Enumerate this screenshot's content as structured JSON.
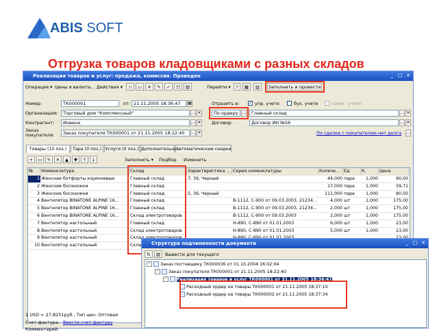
{
  "logo": {
    "brand_bold": "ABIS",
    "brand_rest": " SOFT"
  },
  "slide_title": "Отгрузка товаров кладовщиками с разных складов",
  "window": {
    "title": "Реализация товаров и услуг: продажа, комиссия. Проведен",
    "toolbar": {
      "operation": "Операция ▾",
      "prices": "Цены и валюта...",
      "actions": "Действия ▾",
      "goto": "Перейти ▾",
      "fill_post": "Заполнить и провести"
    },
    "form": {
      "number_label": "Номер:",
      "number_value": "ТК000001",
      "from_label": "от:",
      "date_value": "21.11.2005 18:36:47",
      "reflect_label": "Отразить в:",
      "mgmt_label": "упр. учете",
      "acct_label": "бух. учете",
      "tax_label": "налог. учете",
      "org_label": "Организация:",
      "org_value": "Торговый дом \"Комплексный\"",
      "by_order_value": "По ордеру",
      "warehouse_value": "Главный склад",
      "contractor_label": "Контрагент:",
      "contractor_value": "Инвена",
      "contract_label": "Договор:",
      "contract_value": "Договор ИН №56",
      "buyer_order_label": "Заказ покупателя:",
      "buyer_order_value": "Заказ покупателя ТК000001 от 21.11.2005 18:22:40",
      "debt_link": "По сделке с покупателем нет долга"
    },
    "tabs": [
      "Товары (10 поз.)",
      "Тара (0 поз.)",
      "Услуги (0 поз.)",
      "Дополнительно",
      "Автоматические скидки"
    ],
    "table_toolbar": {
      "fill": "Заполнить ▾",
      "select": "Подбор",
      "change": "Изменить"
    },
    "columns": [
      "№",
      "Номенклатура",
      "Склад",
      "Характеристика ...",
      "Серия номенклатуры",
      "Количе...",
      "Ед.",
      "К.",
      "Цена"
    ],
    "rows": [
      {
        "n": "1",
        "item": "Женские ботфорты коричневые",
        "wh": "Главный склад",
        "ch": "7, 39, Черный",
        "ser": "",
        "qty": "44,000",
        "unit": "пара",
        "k": "1,000",
        "price": "90,00"
      },
      {
        "n": "2",
        "item": "Женские босоножки",
        "wh": "Главный склад",
        "ch": "",
        "ser": "",
        "qty": "17,000",
        "unit": "пара",
        "k": "1,000",
        "price": "59,71"
      },
      {
        "n": "3",
        "item": "Женские босоножки",
        "wh": "Главный склад",
        "ch": "5, 36, Черный",
        "ser": "",
        "qty": "111,000",
        "unit": "пара",
        "k": "1,000",
        "price": "80,00"
      },
      {
        "n": "4",
        "item": "Вентилятор BINATONE ALPINE 16...",
        "wh": "Главный склад",
        "ch": "",
        "ser": "В-1112, С-900 от 09.03.2003, 21234...",
        "qty": "4,000",
        "unit": "шт",
        "k": "1,000",
        "price": "175,00"
      },
      {
        "n": "5",
        "item": "Вентилятор BINATONE ALPINE 16...",
        "wh": "Главный склад",
        "ch": "",
        "ser": "В-1112, С-900 от 09.03.2003, 21234...",
        "qty": "2,000",
        "unit": "шт",
        "k": "1,000",
        "price": "175,00"
      },
      {
        "n": "6",
        "item": "Вентилятор BINATONE ALPINE 16...",
        "wh": "Склад электротоваров",
        "ch": "",
        "ser": "В-1112, С-900 от 09.03.2003",
        "qty": "2,000",
        "unit": "шт",
        "k": "1,000",
        "price": "175,00"
      },
      {
        "n": "7",
        "item": "Вентилятор настольный",
        "wh": "Главный склад",
        "ch": "",
        "ser": "Н-890, С-890 от 01.01.2003",
        "qty": "6,000",
        "unit": "шт",
        "k": "1,000",
        "price": "23,00"
      },
      {
        "n": "8",
        "item": "Вентилятор настольный",
        "wh": "Склад электротоваров",
        "ch": "",
        "ser": "Н-890, С-890 от 01.01.2003",
        "qty": "5,000",
        "unit": "шт",
        "k": "1,000",
        "price": "23,00"
      },
      {
        "n": "9",
        "item": "Вентилятор настольный",
        "wh": "Склад электротоваров",
        "ch": "",
        "ser": "Н-890, С-890 от 01.01.2003",
        "qty": "",
        "unit": "",
        "k": "",
        "price": "23,00"
      },
      {
        "n": "10",
        "item": "Вентилятор настольный",
        "wh": "Склад электротоваров",
        "ch": "",
        "ser": "",
        "qty": "",
        "unit": "",
        "k": "",
        "price": "23,00"
      }
    ],
    "footer": {
      "rate": "1 USD = 27,8251руб., Тип цен: Оптовая",
      "invoice_label": "Счет-фактура:",
      "invoice_link": "Ввести счет-фактуру",
      "comment_label": "Комментарий:"
    }
  },
  "window2": {
    "title": "Структура подчиненности документа",
    "print_btn": "Вывести для текущего",
    "nodes": [
      "Заказ поставщику ТК000036 от 01.10.2004 16:02:04",
      "Заказ покупателя ТК000001 от 21.11.2005 18:22:40",
      "Реализация товаров и услуг ТК000001 от 21.11.2005 18:36:47",
      "Расходный ордер на товары ТК000001 от 21.11.2005 18:37:10",
      "Расходный ордер на товары ТК000002 от 21.11.2005 18:37:34"
    ]
  }
}
